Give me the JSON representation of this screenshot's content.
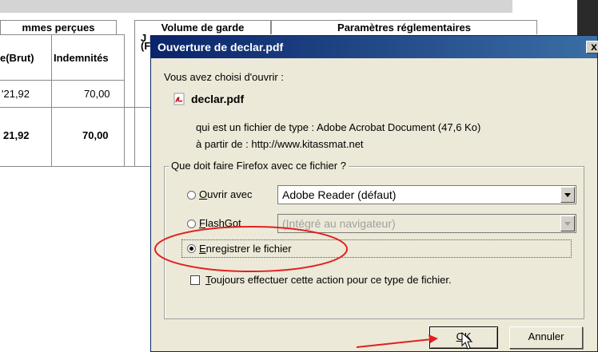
{
  "table": {
    "groups": [
      "mmes perçues",
      "Volume de garde",
      "Paramètres réglementaires"
    ],
    "columns": [
      "e(Brut)",
      "Indemnités"
    ],
    "partial_header": "J p (F",
    "rows": [
      {
        "brut": "'21,92",
        "indemnites": "70,00"
      },
      {
        "brut": "21,92",
        "indemnites": "70,00"
      }
    ]
  },
  "dialog": {
    "title": "Ouverture de declar.pdf",
    "close_label": "x",
    "intro": "Vous avez choisi d'ouvrir :",
    "filename": "declar.pdf",
    "type_line": "qui est un fichier de type : Adobe Acrobat Document (47,6 Ko)",
    "source_line": "à partir de : http://www.kitassmat.net",
    "question": "Que doit faire Firefox avec ce fichier ?",
    "options": [
      {
        "key": "O",
        "rest": "uvrir avec",
        "selected": false,
        "combo": "Adobe Reader  (défaut)",
        "combo_disabled": false
      },
      {
        "key": "F",
        "rest": "lashGot",
        "selected": false,
        "combo": "(Intégré au navigateur)",
        "combo_disabled": true
      },
      {
        "key": "E",
        "rest": "nregistrer le fichier",
        "selected": true
      }
    ],
    "always_key": "T",
    "always_rest": "oujours effectuer cette action pour ce type de fichier.",
    "always_checked": false,
    "ok_key": "O",
    "ok_rest": "K",
    "cancel_label": "Annuler"
  },
  "icons": [
    "pdf-file-icon",
    "mouse-cursor-icon"
  ],
  "colors": {
    "titlebar": "#0a246a",
    "dialog_bg": "#ece9d8",
    "annotation": "#e02020"
  }
}
